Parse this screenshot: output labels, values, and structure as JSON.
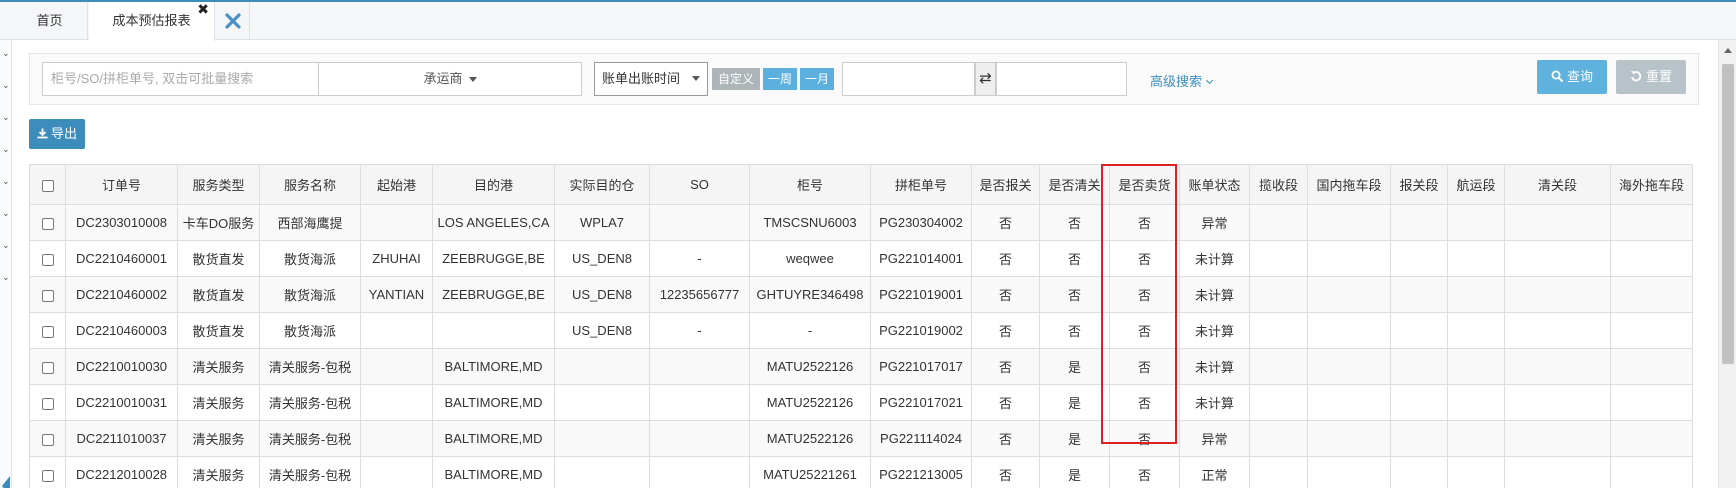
{
  "tabs": [
    {
      "label": "首页"
    },
    {
      "label": "成本预估报表",
      "active": true
    }
  ],
  "search": {
    "placeholder": "柜号/SO/拼柜单号, 双击可批量搜索",
    "carrier_label": "承运商",
    "date_type": "账单出账时间",
    "custom_label": "自定义",
    "week_label": "一周",
    "month_label": "一月",
    "swap_symbol": "⇄",
    "advanced_label": "高级搜索",
    "query_label": "查询",
    "reset_label": "重置"
  },
  "toolbar": {
    "export_label": "导出"
  },
  "table": {
    "columns": [
      "订单号",
      "服务类型",
      "服务名称",
      "起始港",
      "目的港",
      "实际目的仓",
      "SO",
      "柜号",
      "拼柜单号",
      "是否报关",
      "是否清关",
      "是否卖货",
      "账单状态",
      "揽收段",
      "国内拖车段",
      "报关段",
      "航运段",
      "清关段",
      "海外拖车段"
    ],
    "rows": [
      [
        "DC2303010008",
        "卡车DO服务",
        "西部海鹰提",
        "",
        "LOS ANGELES,CA",
        "WPLA7",
        "",
        "TMSCSNU6003",
        "PG230304002",
        "否",
        "否",
        "否",
        "异常",
        "",
        "",
        "",
        "",
        "",
        ""
      ],
      [
        "DC2210460001",
        "散货直发",
        "散货海派",
        "ZHUHAI",
        "ZEEBRUGGE,BE",
        "US_DEN8",
        "-",
        "weqwee",
        "PG221014001",
        "否",
        "否",
        "否",
        "未计算",
        "",
        "",
        "",
        "",
        "",
        ""
      ],
      [
        "DC2210460002",
        "散货直发",
        "散货海派",
        "YANTIAN",
        "ZEEBRUGGE,BE",
        "US_DEN8",
        "12235656777",
        "GHTUYRE346498",
        "PG221019001",
        "否",
        "否",
        "否",
        "未计算",
        "",
        "",
        "",
        "",
        "",
        ""
      ],
      [
        "DC2210460003",
        "散货直发",
        "散货海派",
        "",
        "",
        "US_DEN8",
        "-",
        "-",
        "PG221019002",
        "否",
        "否",
        "否",
        "未计算",
        "",
        "",
        "",
        "",
        "",
        ""
      ],
      [
        "DC2210010030",
        "清关服务",
        "清关服务-包税",
        "",
        "BALTIMORE,MD",
        "",
        "",
        "MATU2522126",
        "PG221017017",
        "否",
        "是",
        "否",
        "未计算",
        "",
        "",
        "",
        "",
        "",
        ""
      ],
      [
        "DC2210010031",
        "清关服务",
        "清关服务-包税",
        "",
        "BALTIMORE,MD",
        "",
        "",
        "MATU2522126",
        "PG221017021",
        "否",
        "是",
        "否",
        "未计算",
        "",
        "",
        "",
        "",
        "",
        ""
      ],
      [
        "DC2211010037",
        "清关服务",
        "清关服务-包税",
        "",
        "BALTIMORE,MD",
        "",
        "",
        "MATU2522126",
        "PG221114024",
        "否",
        "是",
        "否",
        "异常",
        "",
        "",
        "",
        "",
        "",
        ""
      ],
      [
        "DC2212010028",
        "清关服务",
        "清关服务-包税",
        "",
        "BALTIMORE,MD",
        "",
        "",
        "MATU25221261",
        "PG221213005",
        "否",
        "是",
        "否",
        "正常",
        "",
        "",
        "",
        "",
        "",
        ""
      ]
    ]
  },
  "colors": {
    "accent": "#3c8dbc",
    "highlight": "#e02020"
  }
}
